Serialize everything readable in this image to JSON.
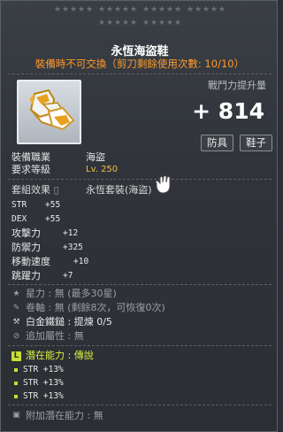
{
  "item": {
    "name": "永恆海盜鞋",
    "warning": "裝備時不可交換（剪刀剩餘使用次數: 10/10）",
    "icon": "boots-icon"
  },
  "power": {
    "label": "戰鬥力提升量",
    "value": "+ 814",
    "tags": [
      "防具",
      "鞋子"
    ]
  },
  "requirements": [
    {
      "label": "裝備職業",
      "value": "海盜"
    },
    {
      "label": "要求等級",
      "value": "Lv. 250"
    }
  ],
  "set": {
    "label": "套組效果",
    "name": "永恆套裝(海盜)"
  },
  "stats": [
    {
      "key": "STR",
      "value": "+55"
    },
    {
      "key": "DEX",
      "value": "+55"
    },
    {
      "key": "攻擊力",
      "value": "+12"
    },
    {
      "key": "防禦力",
      "value": "+325"
    },
    {
      "key": "移動速度",
      "value": "+10"
    },
    {
      "key": "跳躍力",
      "value": "+7"
    }
  ],
  "extras": [
    {
      "icon": "star-icon",
      "text": "星力 : 無 (最多30星)"
    },
    {
      "icon": "scroll-icon",
      "text": "卷軸 : 無 (剩餘8次，可恢復0次)"
    },
    {
      "icon": "hammer-icon",
      "text": "白金鐵鎚 : 提煉 0/5"
    },
    {
      "icon": "flame-icon",
      "text": "追加屬性 : 無"
    }
  ],
  "potential": {
    "badge": "L",
    "title": "潛在能力 : 傳說",
    "lines": [
      "STR +13%",
      "STR +13%",
      "STR +13%"
    ]
  },
  "additional_potential": {
    "icon": "lock-icon",
    "text": "附加潛在能力 : 無"
  },
  "colors": {
    "warning": "#ff9a2e",
    "legendary": "#c8e030",
    "level": "#f0c040"
  }
}
